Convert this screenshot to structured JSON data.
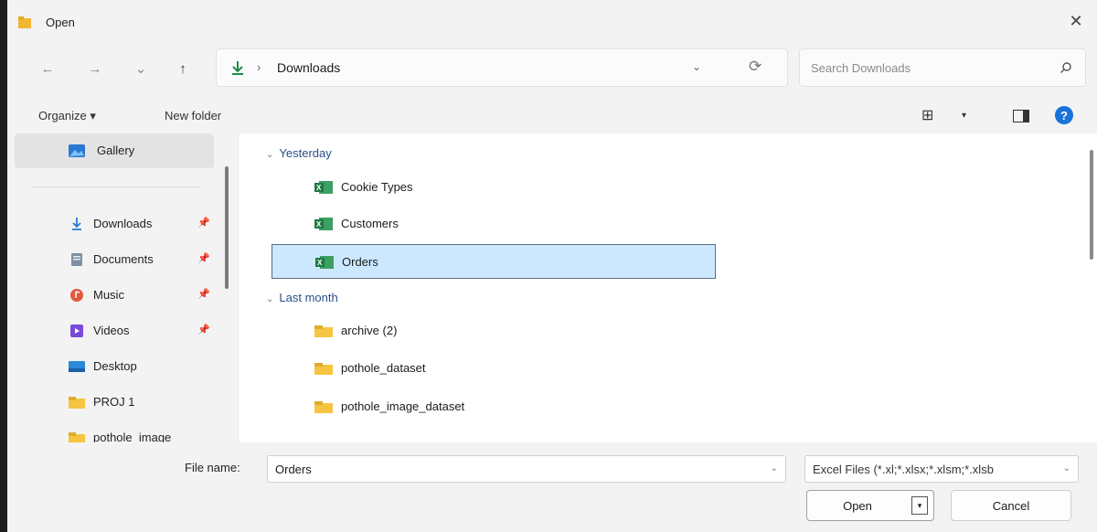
{
  "window": {
    "title": "Open",
    "close_label": "✕"
  },
  "navigation": {
    "back": "←",
    "forward": "→",
    "recent": "⌄",
    "up": "↑",
    "path_separator": "›",
    "path": "Downloads",
    "refresh": "⟳",
    "search_placeholder": "Search Downloads"
  },
  "toolbar": {
    "organize": "Organize ▾",
    "new_folder": "New folder",
    "view": "⊞",
    "view_drop": "▾",
    "help": "?"
  },
  "sidebar": {
    "items": [
      {
        "label": "Gallery",
        "icon": "gallery-icon"
      },
      {
        "label": "Downloads",
        "icon": "download-icon",
        "pinned": "📌"
      },
      {
        "label": "Documents",
        "icon": "document-icon",
        "pinned": "📌"
      },
      {
        "label": "Music",
        "icon": "music-icon",
        "pinned": "📌"
      },
      {
        "label": "Videos",
        "icon": "video-icon",
        "pinned": "📌"
      },
      {
        "label": "Desktop",
        "icon": "desktop-icon"
      },
      {
        "label": "PROJ 1",
        "icon": "folder-icon"
      },
      {
        "label": "pothole_image",
        "icon": "folder-icon"
      }
    ]
  },
  "content": {
    "groups": [
      {
        "header": "Yesterday",
        "files": [
          {
            "name": "Cookie Types",
            "type": "excel"
          },
          {
            "name": "Customers",
            "type": "excel"
          },
          {
            "name": "Orders",
            "type": "excel",
            "selected": true
          }
        ]
      },
      {
        "header": "Last month",
        "files": [
          {
            "name": "archive (2)",
            "type": "folder"
          },
          {
            "name": "pothole_dataset",
            "type": "folder"
          },
          {
            "name": "pothole_image_dataset",
            "type": "folder"
          }
        ]
      }
    ]
  },
  "footer": {
    "file_name_label": "File name:",
    "file_name_value": "Orders",
    "filter_value": "Excel Files (*.xl;*.xlsx;*.xlsm;*.xlsb",
    "open_label": "Open",
    "open_split": "▾",
    "cancel_label": "Cancel"
  },
  "colors": {
    "accent": "#1a73d9",
    "selection": "#cce8ff",
    "excel_green": "#1f7a45",
    "folder_yellow": "#f5c542"
  }
}
